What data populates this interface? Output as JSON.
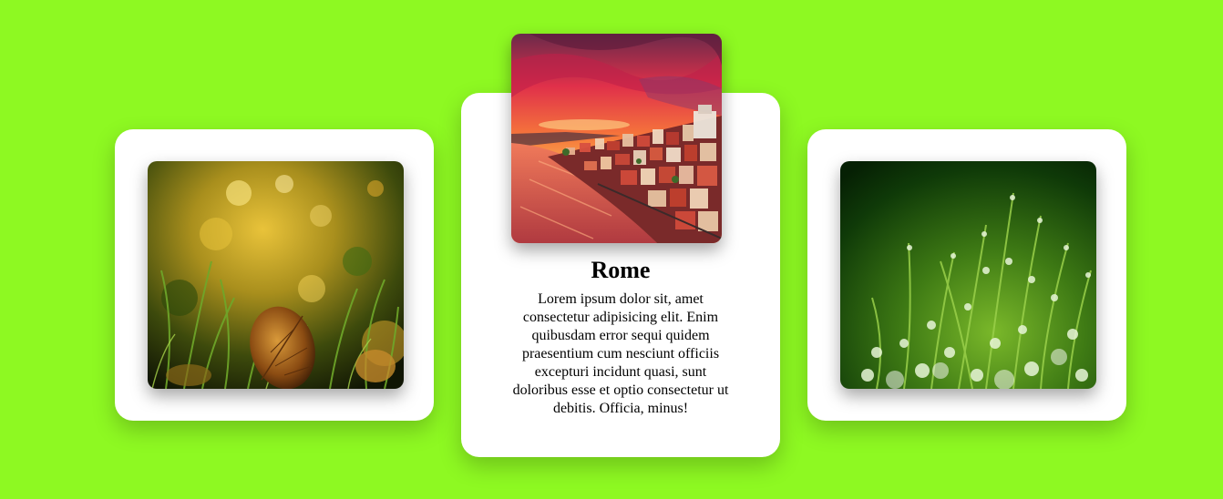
{
  "cards": [
    {
      "name": "card-left",
      "image": "autumn-leaf-grass-photo",
      "title": "",
      "text": ""
    },
    {
      "name": "card-center",
      "image": "rome-sunset-city-photo",
      "title": "Rome",
      "text": "Lorem ipsum dolor sit, amet consectetur adipisicing elit. Enim quibusdam error sequi quidem praesentium cum nesciunt officiis excepturi incidunt quasi, sunt doloribus esse et optio consectetur ut debitis. Officia, minus!"
    },
    {
      "name": "card-right",
      "image": "dewy-grass-photo",
      "title": "",
      "text": ""
    }
  ],
  "colors": {
    "background": "#8ef922",
    "card": "#ffffff"
  }
}
